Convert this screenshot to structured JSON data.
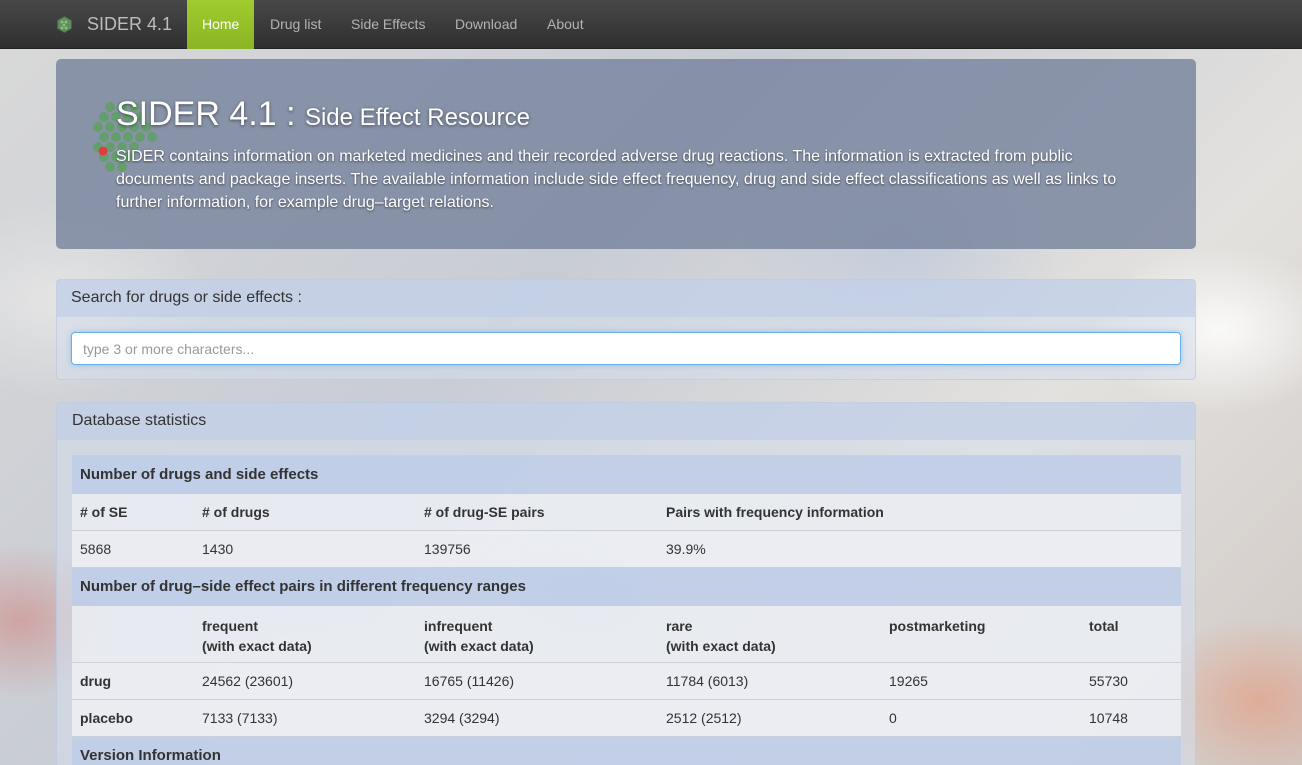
{
  "navbar": {
    "brand": "SIDER 4.1",
    "items": [
      {
        "label": "Home",
        "active": true
      },
      {
        "label": "Drug list",
        "active": false
      },
      {
        "label": "Side Effects",
        "active": false
      },
      {
        "label": "Download",
        "active": false
      },
      {
        "label": "About",
        "active": false
      }
    ],
    "active_color": "#9acd32"
  },
  "hero": {
    "title": "SIDER 4.1 :",
    "subtitle": "Side Effect Resource",
    "description": "SIDER contains information on marketed medicines and their recorded adverse drug reactions. The information is extracted from public documents and package inserts. The available information include side effect frequency, drug and side effect classifications as well as links to further information, for example drug–target relations."
  },
  "search": {
    "heading": "Search for drugs or side effects :",
    "placeholder": "type 3 or more characters...",
    "value": ""
  },
  "stats": {
    "heading": "Database statistics",
    "section1_title": "Number of drugs and side effects",
    "section1_headers": [
      "# of SE",
      "# of drugs",
      "# of drug-SE pairs",
      "Pairs with frequency information"
    ],
    "section1_values": [
      "5868",
      "1430",
      "139756",
      "39.9%"
    ],
    "section2_title": "Number of drug–side effect pairs in different frequency ranges",
    "section2_headers": [
      {
        "line1": "",
        "line2": ""
      },
      {
        "line1": "frequent",
        "line2": "(with exact data)"
      },
      {
        "line1": "infrequent",
        "line2": "(with exact data)"
      },
      {
        "line1": "rare",
        "line2": "(with exact data)"
      },
      {
        "line1": "postmarketing",
        "line2": ""
      },
      {
        "line1": "total",
        "line2": ""
      }
    ],
    "section2_rows": [
      {
        "label": "drug",
        "frequent": "24562 (23601)",
        "infrequent": "16765 (11426)",
        "rare": "11784 (6013)",
        "postmarketing": "19265",
        "total": "55730"
      },
      {
        "label": "placebo",
        "frequent": "7133 (7133)",
        "infrequent": "3294 (3294)",
        "rare": "2512 (2512)",
        "postmarketing": "0",
        "total": "10748"
      }
    ],
    "section3_title": "Version Information"
  }
}
